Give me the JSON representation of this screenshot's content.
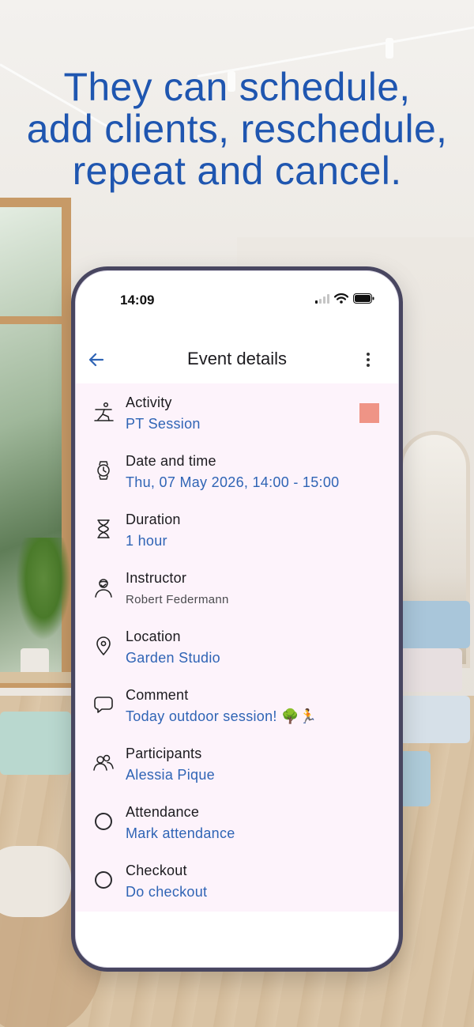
{
  "headline": {
    "line1": "They can schedule,",
    "line2": "add clients, reschedule,",
    "line3": "repeat and cancel."
  },
  "status_bar": {
    "time": "14:09",
    "icons": [
      "cellular-signal-icon",
      "wifi-icon",
      "battery-icon"
    ]
  },
  "app_bar": {
    "title": "Event details",
    "back_icon": "arrow-left-icon",
    "menu_icon": "more-vertical-icon"
  },
  "details": [
    {
      "label": "Activity",
      "value": "PT Session",
      "icon": "yoga-pose-icon",
      "color": "#ef9486"
    },
    {
      "label": "Date and time",
      "value": "Thu, 07 May 2026, 14:00 - 15:00",
      "icon": "watch-icon"
    },
    {
      "label": "Duration",
      "value": "1 hour",
      "icon": "hourglass-icon"
    },
    {
      "label": "Instructor",
      "value": "Robert Federmann",
      "icon": "instructor-icon"
    },
    {
      "label": "Location",
      "value": "Garden Studio",
      "icon": "location-pin-icon"
    },
    {
      "label": "Comment",
      "value": "Today outdoor session! 🌳🏃",
      "icon": "comment-icon"
    },
    {
      "label": "Participants",
      "value": "Alessia Pique",
      "icon": "participants-icon"
    },
    {
      "label": "Attendance",
      "value": "Mark attendance",
      "icon": "circle-icon"
    },
    {
      "label": "Checkout",
      "value": "Do checkout",
      "icon": "circle-icon"
    }
  ],
  "colors": {
    "headline": "#1f56b0",
    "link": "#2f64b5",
    "details_background": "#fdf3fb",
    "phone_frame": "#484660",
    "activity_color": "#ef9486"
  }
}
